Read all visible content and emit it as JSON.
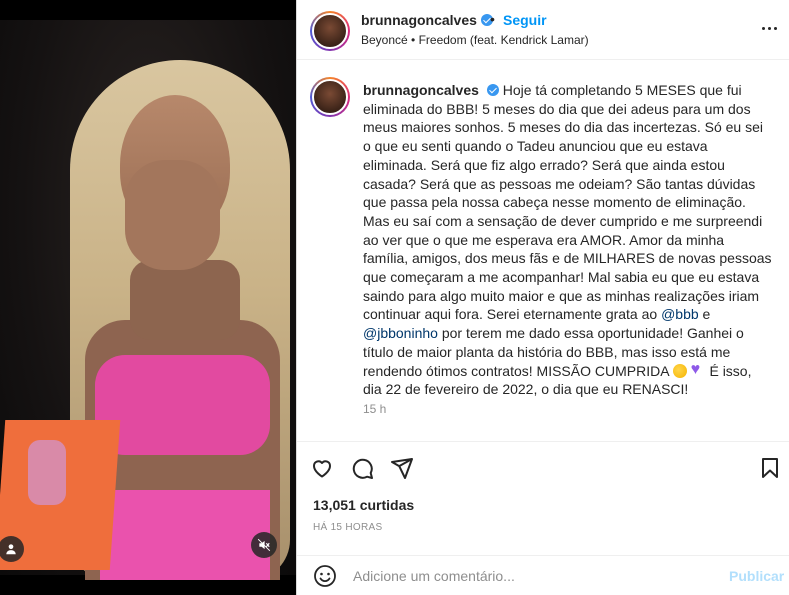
{
  "header": {
    "username": "brunnagoncalves",
    "dot": "•",
    "follow_label": "Seguir",
    "audio": "Beyoncé • Freedom (feat. Kendrick Lamar)",
    "more_icon": "more-horizontal-icon"
  },
  "caption": {
    "username": "brunnagoncalves",
    "text_part1": "Hoje tá completando 5 MESES que fui eliminada do BBB! 5 meses do dia que dei adeus para um dos meus maiores sonhos. 5 meses do dia das incertezas. Só eu sei o que eu senti quando o Tadeu anunciou que eu estava eliminada. Será que fiz algo errado? Será que ainda estou casada? Será que as pessoas me odeiam? São tantas dúvidas que passa pela nossa cabeça nesse momento de eliminação. Mas eu saí com a sensação de dever cumprido e me surpreendi ao ver que o que me esperava era AMOR. Amor da minha família, amigos, dos meus fãs e de MILHARES de novas pessoas que começaram a me acompanhar! Mal sabia eu que eu estava saindo para algo muito maior e que as minhas realizações iriam continuar aqui fora. Serei eternamente grata ao ",
    "mention1": "@bbb",
    "text_part2": " e ",
    "mention2": "@jbboninho",
    "text_part3": " por terem me dado essa oportunidade! Ganhei o título de maior planta da história do BBB, mas isso está me rendendo ótimos contratos! MISSÃO CUMPRIDA ",
    "text_part4": " É isso, dia 22 de fevereiro de 2022, o dia que eu RENASCI!",
    "emoji1": "rofl-emoji",
    "emoji2": "purple-heart-emoji",
    "time": "15 h"
  },
  "actions": {
    "like_icon": "heart-icon",
    "comment_icon": "comment-icon",
    "share_icon": "send-icon",
    "save_icon": "bookmark-icon"
  },
  "likes": "13,051 curtidas",
  "posted_ago": "HÁ 15 HORAS",
  "comment": {
    "placeholder": "Adicione um comentário...",
    "post_label": "Publicar",
    "emoji_icon": "smile-icon"
  },
  "media": {
    "tagged_icon": "user-tag-icon",
    "mute_icon": "muted-speaker-icon"
  },
  "colors": {
    "accent": "#0095f6",
    "post_disabled": "#b2dffc",
    "muted_text": "#8e8e8e",
    "verified": "#3897f0"
  }
}
